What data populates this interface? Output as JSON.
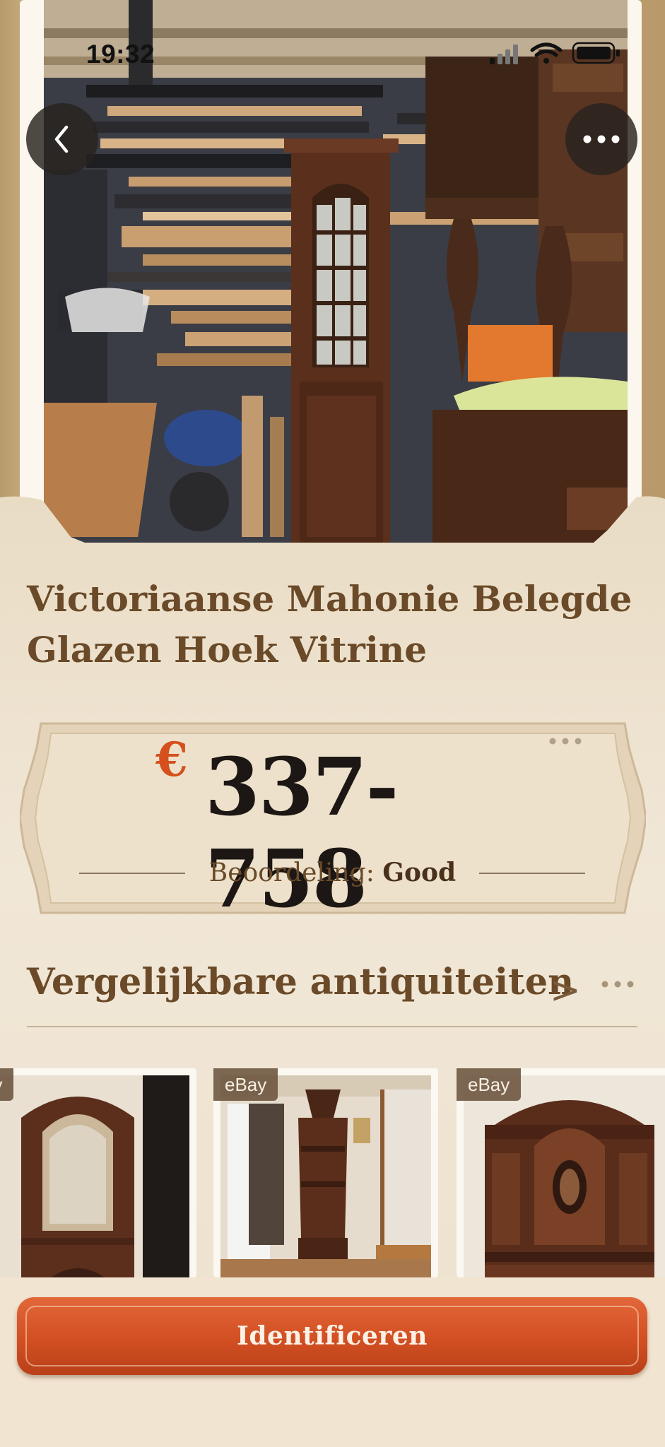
{
  "status_bar": {
    "time": "19:32",
    "icons": [
      "signal-icon",
      "wifi-icon",
      "battery-icon"
    ]
  },
  "nav": {
    "back_icon": "chevron-left-icon",
    "more_icon": "ellipsis-icon"
  },
  "item": {
    "title": "Victoriaanse Mahonie Belegde Glazen Hoek Vitrine",
    "currency": "€",
    "price_range": "337-758",
    "rating_label": "Beoordeling:",
    "rating_value": "Good"
  },
  "comparables": {
    "title": "Vergelijkbare antiquiteiten",
    "chevron": ">",
    "cards": [
      {
        "source": "ay"
      },
      {
        "source": "eBay"
      },
      {
        "source": "eBay"
      }
    ]
  },
  "actions": {
    "identify_label": "Identificeren"
  },
  "colors": {
    "accent": "#d6501e",
    "title": "#6a4a28",
    "background": "#efe4d2"
  }
}
